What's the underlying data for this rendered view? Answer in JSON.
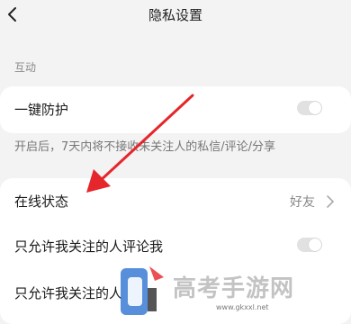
{
  "nav": {
    "title": "隐私设置"
  },
  "section": {
    "label": "互动"
  },
  "protection": {
    "label": "一键防护",
    "enabled": false,
    "hint": "开启后，7天内将不接收未关注人的私信/评论/分享"
  },
  "online_status": {
    "label": "在线状态",
    "value": "好友"
  },
  "comment_only_following": {
    "label": "只允许我关注的人评论我",
    "enabled": false
  },
  "only_following_partial": {
    "label": "只允许我关注的人"
  },
  "watermark": {
    "text": "高考手游网",
    "url": "www.gkxxl.net"
  },
  "colors": {
    "accent_arrow": "#e5262b",
    "toggle_off": "#e1e1e1"
  }
}
